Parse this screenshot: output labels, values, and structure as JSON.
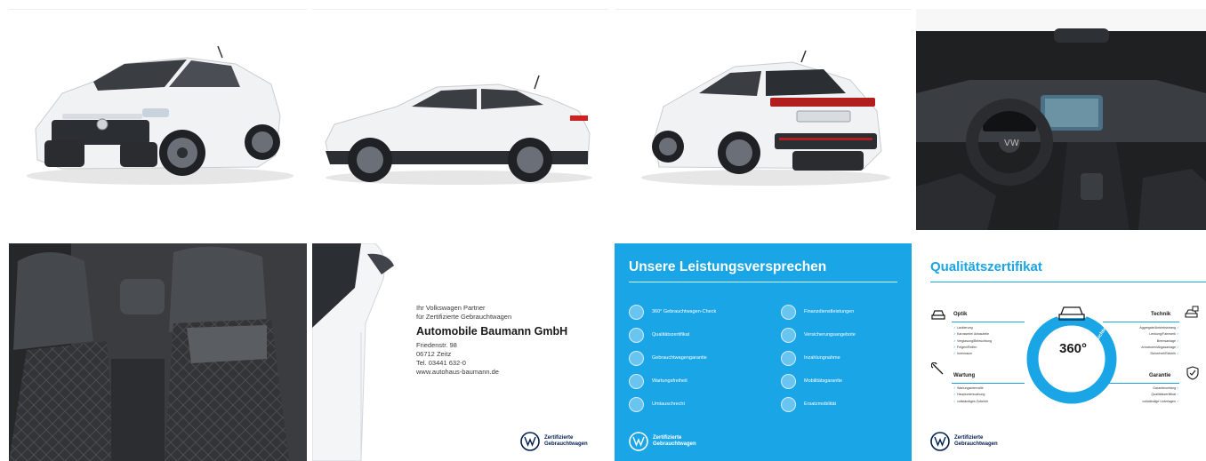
{
  "dealer": {
    "partner_line1": "Ihr Volkswagen Partner",
    "partner_line2": "für Zertifizierte Gebrauchtwagen",
    "company": "Automobile Baumann GmbH",
    "street": "Friedenstr. 98",
    "city": "06712 Zeitz",
    "phone": "Tel. 03441 632-0",
    "web": "www.autohaus-baumann.de"
  },
  "cert_label": {
    "line1": "Zertifizierte",
    "line2": "Gebrauchtwagen"
  },
  "services": {
    "title": "Unsere Leistungsversprechen",
    "left": [
      "360° Gebrauchtwagen-Check",
      "Qualitätszertifikat",
      "Gebrauchtwagengarantie",
      "Wartungsfreiheit",
      "Umtauschrecht"
    ],
    "right": [
      "Finanzdienstleistungen",
      "Versicherungsangebote",
      "Inzahlungnahme",
      "Mobilitätsgarantie",
      "Ersatzmobilität"
    ]
  },
  "quality": {
    "title": "Qualitätszertifikat",
    "optik": {
      "label": "Optik",
      "items": [
        "Lackierung",
        "Karosserie/ Anbauteile",
        "Verglasung/Beleuchtung",
        "Felgen/Reifen",
        "Innenraum"
      ]
    },
    "wartung": {
      "label": "Wartung",
      "items": [
        "Wartungsintervalle",
        "Hauptuntersuchung",
        "vollständiges Zubehör"
      ]
    },
    "technik": {
      "label": "Technik",
      "items": [
        "Aggregate/Antriebsstrang",
        "Lenkung/Fahrwerk",
        "Bremsanlage",
        "Armaturen/Abgasanlage",
        "Sicherheit/Elektrik"
      ]
    },
    "garantie": {
      "label": "Garantie",
      "items": [
        "Garantieumfang",
        "Qualitätszertifikat",
        "vollständige Unterlagen"
      ]
    },
    "ring_value": "360°",
    "ring_label": "Gebrauchtwagen-Check"
  },
  "colors": {
    "vw_blue": "#1aa5e6",
    "vw_navy": "#001e50",
    "car_white": "#f3f4f6"
  },
  "icons": [
    "vw-logo-icon",
    "service-circle-icon",
    "car-icon",
    "wrench-icon",
    "shield-icon"
  ]
}
